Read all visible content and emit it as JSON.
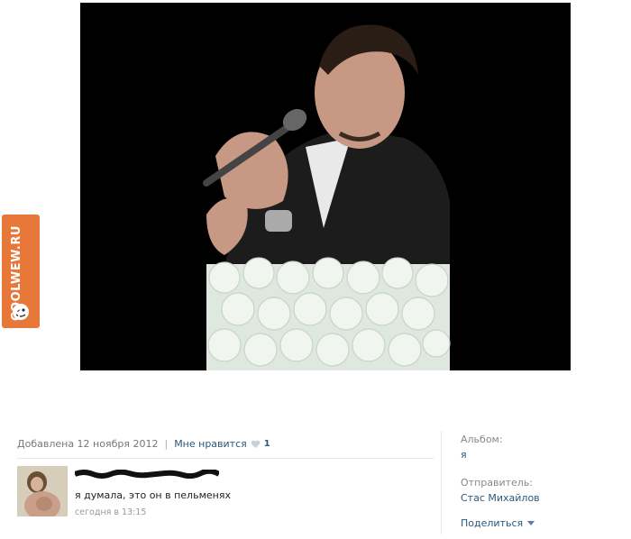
{
  "watermark": {
    "text": "COOLWEW.RU"
  },
  "photo": {
    "background": "#000000"
  },
  "info": {
    "added": "Добавлена 12 ноября 2012",
    "separator": "|",
    "like_label": "Мне нравится",
    "like_count": "1"
  },
  "comment": {
    "text": "я думала, это он в пельменях",
    "time": "сегодня в 13:15"
  },
  "sidebar": {
    "album_label": "Альбом:",
    "album_value": "я",
    "sender_label": "Отправитель:",
    "sender_value": "Стас Михайлов",
    "share_label": "Поделиться"
  },
  "colors": {
    "link": "#2b587a",
    "muted": "#777777",
    "watermark_bg": "#e8783a"
  }
}
